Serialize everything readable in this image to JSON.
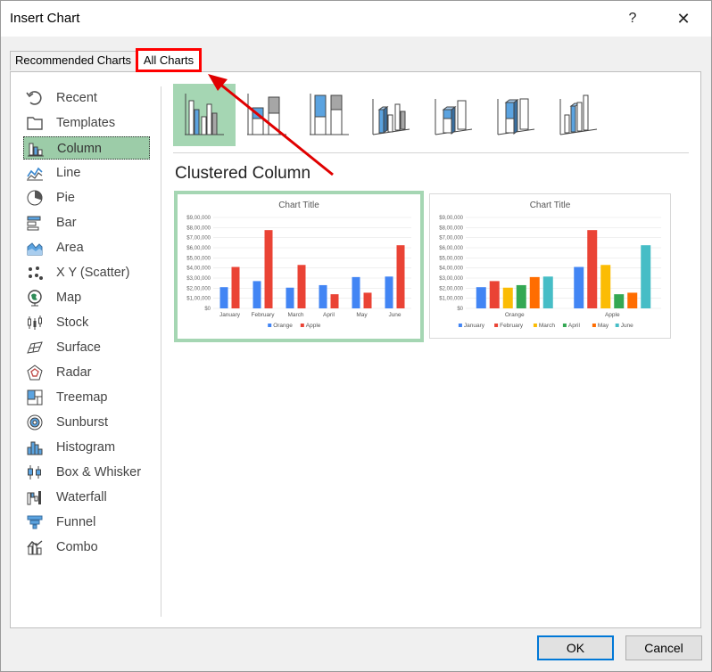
{
  "window": {
    "title": "Insert Chart",
    "help_label": "?",
    "close_label": "✕"
  },
  "tabs": [
    {
      "label": "Recommended Charts"
    },
    {
      "label": "All Charts"
    }
  ],
  "categories": [
    {
      "label": "Recent",
      "icon": "recent-icon"
    },
    {
      "label": "Templates",
      "icon": "templates-icon"
    },
    {
      "label": "Column",
      "icon": "column-chart-icon",
      "selected": true
    },
    {
      "label": "Line",
      "icon": "line-chart-icon"
    },
    {
      "label": "Pie",
      "icon": "pie-chart-icon"
    },
    {
      "label": "Bar",
      "icon": "bar-chart-icon"
    },
    {
      "label": "Area",
      "icon": "area-chart-icon"
    },
    {
      "label": "X Y (Scatter)",
      "icon": "scatter-chart-icon"
    },
    {
      "label": "Map",
      "icon": "map-chart-icon"
    },
    {
      "label": "Stock",
      "icon": "stock-chart-icon"
    },
    {
      "label": "Surface",
      "icon": "surface-chart-icon"
    },
    {
      "label": "Radar",
      "icon": "radar-chart-icon"
    },
    {
      "label": "Treemap",
      "icon": "treemap-chart-icon"
    },
    {
      "label": "Sunburst",
      "icon": "sunburst-chart-icon"
    },
    {
      "label": "Histogram",
      "icon": "histogram-chart-icon"
    },
    {
      "label": "Box & Whisker",
      "icon": "box-whisker-chart-icon"
    },
    {
      "label": "Waterfall",
      "icon": "waterfall-chart-icon"
    },
    {
      "label": "Funnel",
      "icon": "funnel-chart-icon"
    },
    {
      "label": "Combo",
      "icon": "combo-chart-icon"
    }
  ],
  "selected_subtype": "Clustered Column",
  "buttons": {
    "ok": "OK",
    "cancel": "Cancel"
  },
  "colors": {
    "selection_green": "#9ccca8",
    "highlight_red": "#ff0000",
    "ok_border": "#0078d7"
  },
  "chart_data": [
    {
      "type": "bar",
      "title": "Chart Title",
      "categories": [
        "January",
        "February",
        "March",
        "April",
        "May",
        "June"
      ],
      "series": [
        {
          "name": "Orange",
          "color": "#4285f4",
          "values": [
            2100000,
            2700000,
            2050000,
            2300000,
            3100000,
            3150000
          ]
        },
        {
          "name": "Apple",
          "color": "#ea4335",
          "values": [
            4100000,
            7750000,
            4300000,
            1400000,
            1550000,
            6250000
          ]
        }
      ],
      "yticks": [
        "$0",
        "$1,00,000",
        "$2,00,000",
        "$3,00,000",
        "$4,00,000",
        "$5,00,000",
        "$6,00,000",
        "$7,00,000",
        "$8,00,000",
        "$9,00,000"
      ],
      "ylim": [
        0,
        9000000
      ],
      "legend": "bottom"
    },
    {
      "type": "bar",
      "title": "Chart Title",
      "categories": [
        "Orange",
        "Apple"
      ],
      "series": [
        {
          "name": "January",
          "color": "#4285f4",
          "values": [
            2100000,
            4100000
          ]
        },
        {
          "name": "February",
          "color": "#ea4335",
          "values": [
            2700000,
            7750000
          ]
        },
        {
          "name": "March",
          "color": "#fbbc04",
          "values": [
            2050000,
            4300000
          ]
        },
        {
          "name": "April",
          "color": "#34a853",
          "values": [
            2300000,
            1400000
          ]
        },
        {
          "name": "May",
          "color": "#ff6d01",
          "values": [
            3100000,
            1550000
          ]
        },
        {
          "name": "June",
          "color": "#46bdc6",
          "values": [
            3150000,
            6250000
          ]
        }
      ],
      "yticks": [
        "$0",
        "$1,00,000",
        "$2,00,000",
        "$3,00,000",
        "$4,00,000",
        "$5,00,000",
        "$6,00,000",
        "$7,00,000",
        "$8,00,000",
        "$9,00,000"
      ],
      "ylim": [
        0,
        9000000
      ],
      "legend": "bottom"
    }
  ]
}
